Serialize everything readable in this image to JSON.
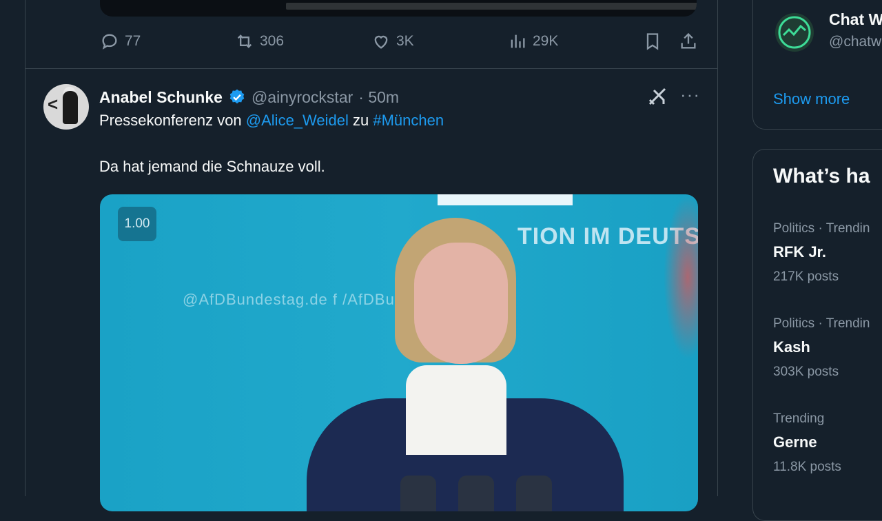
{
  "previous_tweet": {
    "actions": {
      "replies": "77",
      "reposts": "306",
      "likes": "3K",
      "views": "29K"
    }
  },
  "tweet": {
    "author_name": "Anabel Schunke",
    "handle": "@ainyrockstar",
    "time": "· 50m",
    "line1_prefix": "Pressekonferenz von ",
    "mention": "@Alice_Weidel",
    "line1_mid": " zu ",
    "hashtag": "#München",
    "line2": "Da hat jemand die Schnauze voll.",
    "media": {
      "playback_speed": "1.00",
      "wall_text": "TION IM DEUTSC",
      "wall_social": "@AfDBundestag.de   f  /AfDBundestag  ·  @AfD"
    }
  },
  "sidebar": {
    "who_to_follow": {
      "name": "Chat W",
      "handle": "@chatw",
      "show_more": "Show more"
    },
    "whats_happening": {
      "title": "What’s ha",
      "trends": [
        {
          "context": "Politics · Trendin",
          "topic": "RFK Jr.",
          "count": "217K posts"
        },
        {
          "context": "Politics · Trendin",
          "topic": "Kash",
          "count": "303K posts"
        },
        {
          "context": "Trending",
          "topic": "Gerne",
          "count": "11.8K posts"
        }
      ]
    }
  },
  "colors": {
    "background": "#15202b",
    "accent": "#1d9bf0",
    "muted": "#8b98a5",
    "border": "#38444d"
  }
}
